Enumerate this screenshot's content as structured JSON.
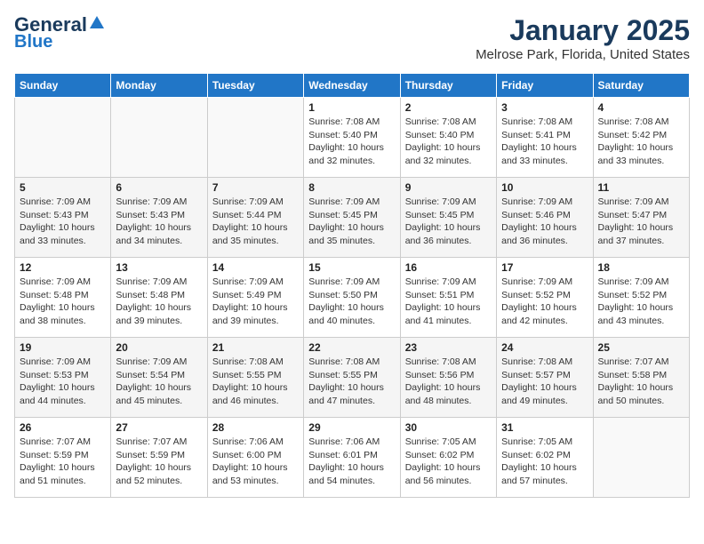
{
  "logo": {
    "line1": "General",
    "line2": "Blue"
  },
  "title": "January 2025",
  "subtitle": "Melrose Park, Florida, United States",
  "days_of_week": [
    "Sunday",
    "Monday",
    "Tuesday",
    "Wednesday",
    "Thursday",
    "Friday",
    "Saturday"
  ],
  "weeks": [
    [
      {
        "day": "",
        "info": ""
      },
      {
        "day": "",
        "info": ""
      },
      {
        "day": "",
        "info": ""
      },
      {
        "day": "1",
        "info": "Sunrise: 7:08 AM\nSunset: 5:40 PM\nDaylight: 10 hours\nand 32 minutes."
      },
      {
        "day": "2",
        "info": "Sunrise: 7:08 AM\nSunset: 5:40 PM\nDaylight: 10 hours\nand 32 minutes."
      },
      {
        "day": "3",
        "info": "Sunrise: 7:08 AM\nSunset: 5:41 PM\nDaylight: 10 hours\nand 33 minutes."
      },
      {
        "day": "4",
        "info": "Sunrise: 7:08 AM\nSunset: 5:42 PM\nDaylight: 10 hours\nand 33 minutes."
      }
    ],
    [
      {
        "day": "5",
        "info": "Sunrise: 7:09 AM\nSunset: 5:43 PM\nDaylight: 10 hours\nand 33 minutes."
      },
      {
        "day": "6",
        "info": "Sunrise: 7:09 AM\nSunset: 5:43 PM\nDaylight: 10 hours\nand 34 minutes."
      },
      {
        "day": "7",
        "info": "Sunrise: 7:09 AM\nSunset: 5:44 PM\nDaylight: 10 hours\nand 35 minutes."
      },
      {
        "day": "8",
        "info": "Sunrise: 7:09 AM\nSunset: 5:45 PM\nDaylight: 10 hours\nand 35 minutes."
      },
      {
        "day": "9",
        "info": "Sunrise: 7:09 AM\nSunset: 5:45 PM\nDaylight: 10 hours\nand 36 minutes."
      },
      {
        "day": "10",
        "info": "Sunrise: 7:09 AM\nSunset: 5:46 PM\nDaylight: 10 hours\nand 36 minutes."
      },
      {
        "day": "11",
        "info": "Sunrise: 7:09 AM\nSunset: 5:47 PM\nDaylight: 10 hours\nand 37 minutes."
      }
    ],
    [
      {
        "day": "12",
        "info": "Sunrise: 7:09 AM\nSunset: 5:48 PM\nDaylight: 10 hours\nand 38 minutes."
      },
      {
        "day": "13",
        "info": "Sunrise: 7:09 AM\nSunset: 5:48 PM\nDaylight: 10 hours\nand 39 minutes."
      },
      {
        "day": "14",
        "info": "Sunrise: 7:09 AM\nSunset: 5:49 PM\nDaylight: 10 hours\nand 39 minutes."
      },
      {
        "day": "15",
        "info": "Sunrise: 7:09 AM\nSunset: 5:50 PM\nDaylight: 10 hours\nand 40 minutes."
      },
      {
        "day": "16",
        "info": "Sunrise: 7:09 AM\nSunset: 5:51 PM\nDaylight: 10 hours\nand 41 minutes."
      },
      {
        "day": "17",
        "info": "Sunrise: 7:09 AM\nSunset: 5:52 PM\nDaylight: 10 hours\nand 42 minutes."
      },
      {
        "day": "18",
        "info": "Sunrise: 7:09 AM\nSunset: 5:52 PM\nDaylight: 10 hours\nand 43 minutes."
      }
    ],
    [
      {
        "day": "19",
        "info": "Sunrise: 7:09 AM\nSunset: 5:53 PM\nDaylight: 10 hours\nand 44 minutes."
      },
      {
        "day": "20",
        "info": "Sunrise: 7:09 AM\nSunset: 5:54 PM\nDaylight: 10 hours\nand 45 minutes."
      },
      {
        "day": "21",
        "info": "Sunrise: 7:08 AM\nSunset: 5:55 PM\nDaylight: 10 hours\nand 46 minutes."
      },
      {
        "day": "22",
        "info": "Sunrise: 7:08 AM\nSunset: 5:55 PM\nDaylight: 10 hours\nand 47 minutes."
      },
      {
        "day": "23",
        "info": "Sunrise: 7:08 AM\nSunset: 5:56 PM\nDaylight: 10 hours\nand 48 minutes."
      },
      {
        "day": "24",
        "info": "Sunrise: 7:08 AM\nSunset: 5:57 PM\nDaylight: 10 hours\nand 49 minutes."
      },
      {
        "day": "25",
        "info": "Sunrise: 7:07 AM\nSunset: 5:58 PM\nDaylight: 10 hours\nand 50 minutes."
      }
    ],
    [
      {
        "day": "26",
        "info": "Sunrise: 7:07 AM\nSunset: 5:59 PM\nDaylight: 10 hours\nand 51 minutes."
      },
      {
        "day": "27",
        "info": "Sunrise: 7:07 AM\nSunset: 5:59 PM\nDaylight: 10 hours\nand 52 minutes."
      },
      {
        "day": "28",
        "info": "Sunrise: 7:06 AM\nSunset: 6:00 PM\nDaylight: 10 hours\nand 53 minutes."
      },
      {
        "day": "29",
        "info": "Sunrise: 7:06 AM\nSunset: 6:01 PM\nDaylight: 10 hours\nand 54 minutes."
      },
      {
        "day": "30",
        "info": "Sunrise: 7:05 AM\nSunset: 6:02 PM\nDaylight: 10 hours\nand 56 minutes."
      },
      {
        "day": "31",
        "info": "Sunrise: 7:05 AM\nSunset: 6:02 PM\nDaylight: 10 hours\nand 57 minutes."
      },
      {
        "day": "",
        "info": ""
      }
    ]
  ]
}
